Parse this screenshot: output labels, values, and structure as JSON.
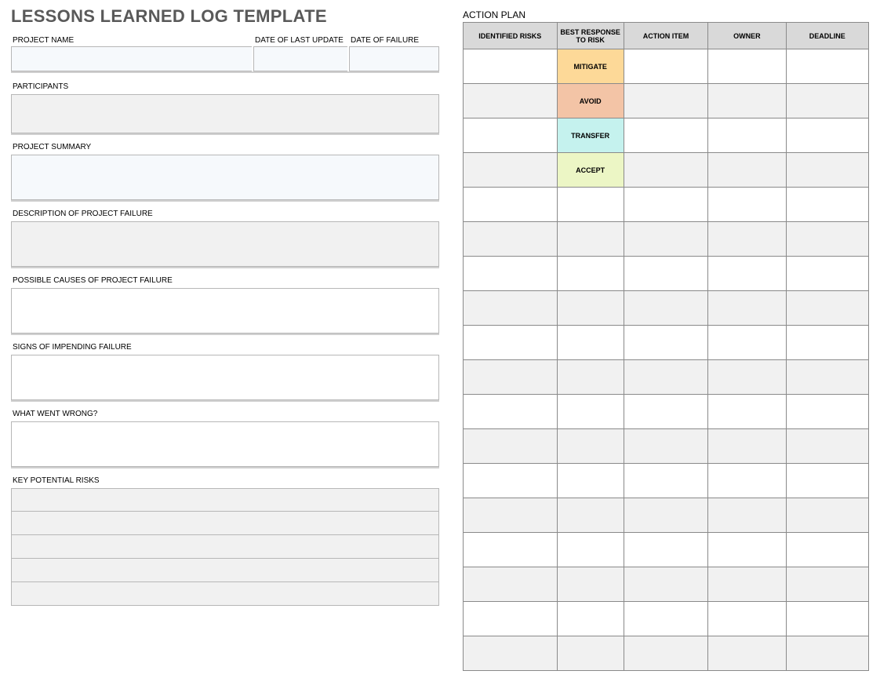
{
  "title": "LESSONS LEARNED LOG TEMPLATE",
  "left": {
    "projectName": {
      "label": "PROJECT NAME",
      "value": ""
    },
    "dateLastUpdate": {
      "label": "DATE OF LAST UPDATE",
      "value": ""
    },
    "dateFailure": {
      "label": "DATE OF FAILURE",
      "value": ""
    },
    "participants": {
      "label": "PARTICIPANTS",
      "value": ""
    },
    "projectSummary": {
      "label": "PROJECT SUMMARY",
      "value": ""
    },
    "descFailure": {
      "label": "DESCRIPTION OF PROJECT FAILURE",
      "value": ""
    },
    "possibleCauses": {
      "label": "POSSIBLE CAUSES OF PROJECT FAILURE",
      "value": ""
    },
    "signs": {
      "label": "SIGNS OF IMPENDING FAILURE",
      "value": ""
    },
    "whatWentWrong": {
      "label": "WHAT WENT WRONG?",
      "value": ""
    },
    "keyRisksLabel": "KEY POTENTIAL RISKS",
    "keyRisks": [
      "",
      "",
      "",
      "",
      ""
    ]
  },
  "actionPlan": {
    "title": "ACTION PLAN",
    "headers": {
      "risks": "IDENTIFIED RISKS",
      "response": "BEST RESPONSE TO RISK",
      "action": "ACTION ITEM",
      "owner": "OWNER",
      "deadline": "DEADLINE"
    },
    "responseTypes": {
      "mitigate": "MITIGATE",
      "avoid": "AVOID",
      "transfer": "TRANSFER",
      "accept": "ACCEPT"
    },
    "rows": [
      {
        "risk": "",
        "response": "mitigate",
        "action": "",
        "owner": "",
        "deadline": ""
      },
      {
        "risk": "",
        "response": "avoid",
        "action": "",
        "owner": "",
        "deadline": ""
      },
      {
        "risk": "",
        "response": "transfer",
        "action": "",
        "owner": "",
        "deadline": ""
      },
      {
        "risk": "",
        "response": "accept",
        "action": "",
        "owner": "",
        "deadline": ""
      },
      {
        "risk": "",
        "response": "",
        "action": "",
        "owner": "",
        "deadline": ""
      },
      {
        "risk": "",
        "response": "",
        "action": "",
        "owner": "",
        "deadline": ""
      },
      {
        "risk": "",
        "response": "",
        "action": "",
        "owner": "",
        "deadline": ""
      },
      {
        "risk": "",
        "response": "",
        "action": "",
        "owner": "",
        "deadline": ""
      },
      {
        "risk": "",
        "response": "",
        "action": "",
        "owner": "",
        "deadline": ""
      },
      {
        "risk": "",
        "response": "",
        "action": "",
        "owner": "",
        "deadline": ""
      },
      {
        "risk": "",
        "response": "",
        "action": "",
        "owner": "",
        "deadline": ""
      },
      {
        "risk": "",
        "response": "",
        "action": "",
        "owner": "",
        "deadline": ""
      },
      {
        "risk": "",
        "response": "",
        "action": "",
        "owner": "",
        "deadline": ""
      },
      {
        "risk": "",
        "response": "",
        "action": "",
        "owner": "",
        "deadline": ""
      },
      {
        "risk": "",
        "response": "",
        "action": "",
        "owner": "",
        "deadline": ""
      },
      {
        "risk": "",
        "response": "",
        "action": "",
        "owner": "",
        "deadline": ""
      },
      {
        "risk": "",
        "response": "",
        "action": "",
        "owner": "",
        "deadline": ""
      },
      {
        "risk": "",
        "response": "",
        "action": "",
        "owner": "",
        "deadline": ""
      }
    ]
  }
}
